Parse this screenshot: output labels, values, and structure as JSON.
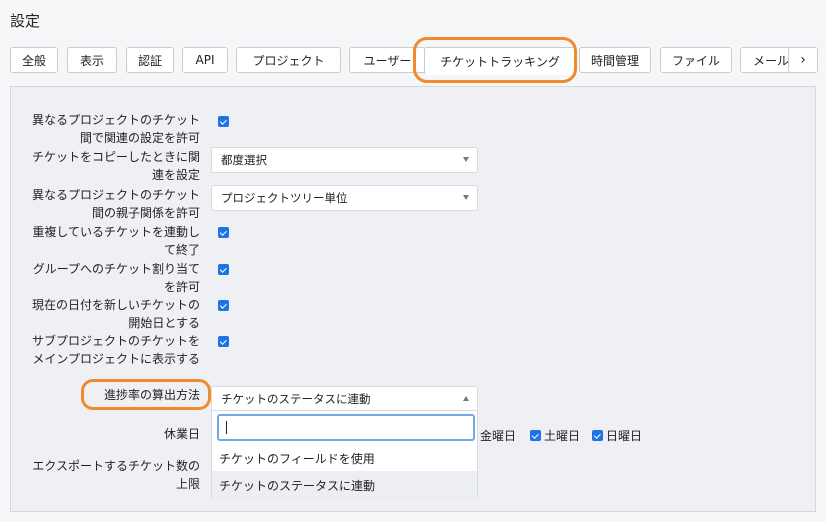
{
  "page": {
    "title": "設定"
  },
  "tabs": [
    {
      "label": "全般"
    },
    {
      "label": "表示"
    },
    {
      "label": "認証"
    },
    {
      "label": "API"
    },
    {
      "label": "プロジェクト"
    },
    {
      "label": "ユーザー"
    },
    {
      "label": "チケットトラッキング"
    },
    {
      "label": "時間管理"
    },
    {
      "label": "ファイル"
    },
    {
      "label": "メール通"
    }
  ],
  "tab_scroll_icon": "›",
  "settings": {
    "cross_project_relations": {
      "label": "異なるプロジェクトのチケット間で関連の設定を許可",
      "checked": true
    },
    "link_copied_issue": {
      "label": "チケットをコピーしたときに関連を設定",
      "value": "都度選択"
    },
    "cross_project_subtasks": {
      "label": "異なるプロジェクトのチケット間の親子関係を許可",
      "value": "プロジェクトツリー単位"
    },
    "close_duplicates": {
      "label": "重複しているチケットを連動して終了",
      "checked": true
    },
    "group_assignment": {
      "label": "グループへのチケット割り当てを許可",
      "checked": true
    },
    "default_start_date": {
      "label": "現在の日付を新しいチケットの開始日とする",
      "checked": true
    },
    "display_subprojects": {
      "label": "サブプロジェクトのチケットをメインプロジェクトに表示する",
      "checked": true
    },
    "done_ratio": {
      "label": "進捗率の算出方法",
      "value": "チケットのステータスに連動",
      "search_value": "",
      "options": [
        "チケットのフィールドを使用",
        "チケットのステータスに連動"
      ]
    },
    "non_working_days": {
      "label": "休業日",
      "days": [
        {
          "label": "金曜日",
          "checked": false
        },
        {
          "label": "土曜日",
          "checked": true
        },
        {
          "label": "日曜日",
          "checked": true
        }
      ]
    },
    "export_limit": {
      "label": "エクスポートするチケット数の上限"
    }
  },
  "colors": {
    "annotation": "#f08a2c",
    "accent": "#1e73e6"
  }
}
